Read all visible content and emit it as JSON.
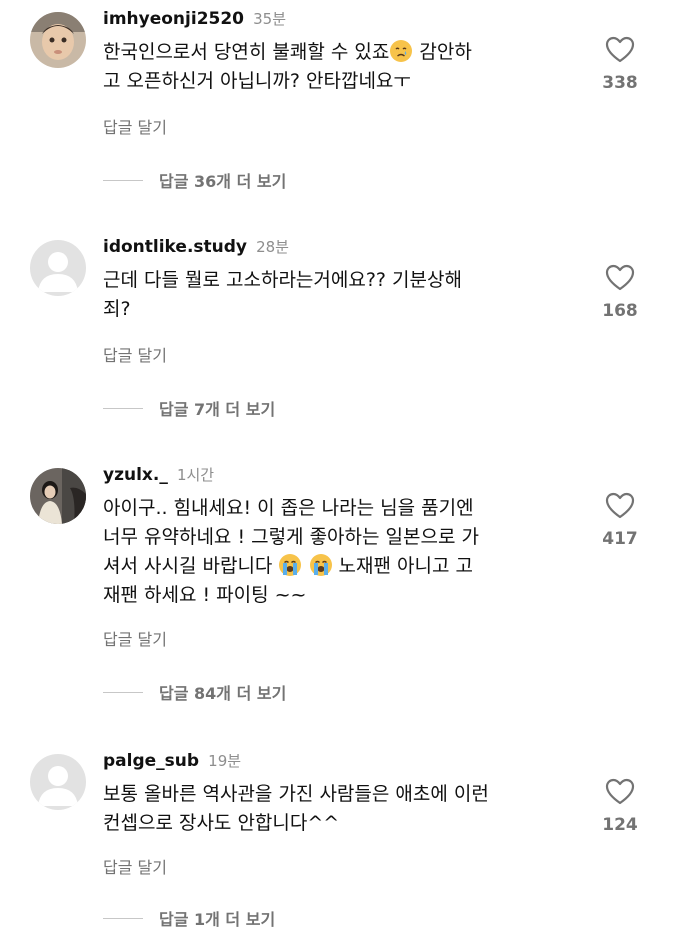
{
  "comments": [
    {
      "username": "imhyeonji2520",
      "time": "35분",
      "line1": "한국인으로서 당연히 불쾌할 수 있죠",
      "line1b": " 감안하",
      "line2": "고 오픈하신거 아닙니까? 안타깝네요ㅜ",
      "likes": "338",
      "reply": "답글 달기",
      "more": "답글 36개 더 보기"
    },
    {
      "username": "idontlike.study",
      "time": "28분",
      "line1": "근데 다들 뭘로 고소하라는거에요?? 기분상해",
      "line2": "죄?",
      "likes": "168",
      "reply": "답글 달기",
      "more": "답글 7개 더 보기"
    },
    {
      "username": "yzulx._",
      "time": "1시간",
      "line1": "아이구.. 힘내세요! 이 좁은 나라는 님을 품기엔",
      "line2": "너무 유약하네요 ! 그렇게 좋아하는 일본으로 가",
      "line3a": "셔서 사시길 바랍니다 ",
      "line3b": " 노재팬 아니고 고",
      "line4": "재팬 하세요 ! 파이팅 ~~",
      "likes": "417",
      "reply": "답글 달기",
      "more": "답글 84개 더 보기"
    },
    {
      "username": "palge_sub",
      "time": "19분",
      "line1": "보통 올바른 역사관을 가진 사람들은 애초에 이런",
      "line2": "컨셉으로 장사도 안합니다^^",
      "likes": "124",
      "reply": "답글 달기",
      "more": "답글 1개 더 보기"
    }
  ],
  "icons": {
    "like": "heart-outline-icon",
    "cry": "crying-face-emoji",
    "sob": "loudly-crying-face-emoji"
  },
  "colors": {
    "secondary": "#737373",
    "primary": "#111111"
  }
}
